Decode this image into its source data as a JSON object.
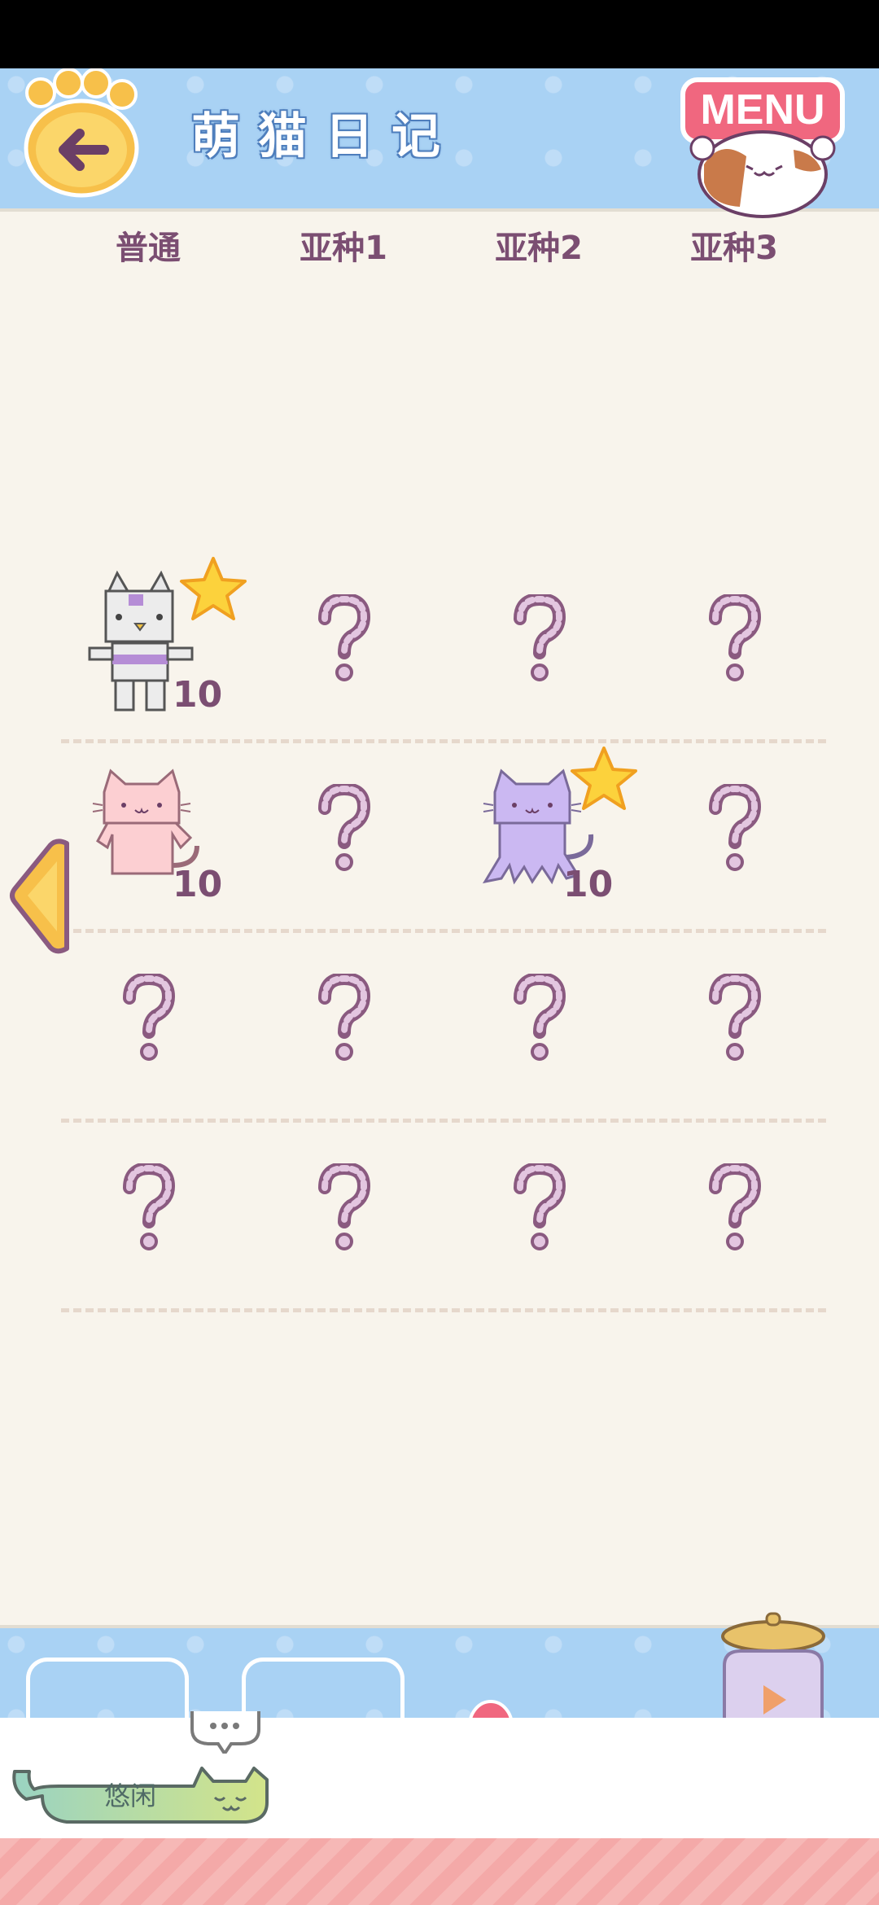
{
  "header": {
    "title": "萌猫日记",
    "menu_label": "MENU",
    "back_icon": "back-arrow-icon"
  },
  "columns": [
    "普通",
    "亚种1",
    "亚种2",
    "亚种3"
  ],
  "rows": [
    [
      {
        "state": "found",
        "cat": "robot-cat",
        "count": "10",
        "star": true
      },
      {
        "state": "unknown"
      },
      {
        "state": "unknown"
      },
      {
        "state": "unknown"
      }
    ],
    [
      {
        "state": "found",
        "cat": "pink-cat",
        "count": "10",
        "star": false
      },
      {
        "state": "unknown"
      },
      {
        "state": "found",
        "cat": "purple-octo-cat",
        "count": "10",
        "star": true
      },
      {
        "state": "unknown"
      }
    ],
    [
      {
        "state": "unknown"
      },
      {
        "state": "unknown"
      },
      {
        "state": "unknown"
      },
      {
        "state": "unknown"
      }
    ],
    [
      {
        "state": "unknown"
      },
      {
        "state": "unknown"
      },
      {
        "state": "unknown"
      },
      {
        "state": "unknown"
      }
    ]
  ],
  "bottom": {
    "status_label": "悠闲"
  },
  "colors": {
    "header_blue": "#a9d2f4",
    "label_purple": "#7b4e72",
    "background": "#f8f4ec",
    "menu_pink": "#f0677f"
  }
}
